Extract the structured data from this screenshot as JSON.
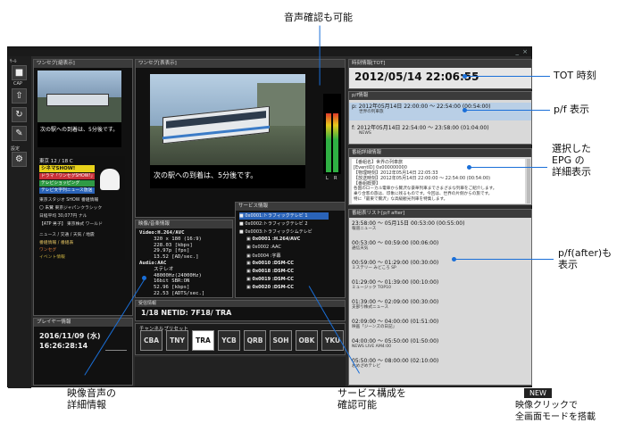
{
  "annotations": {
    "audio_check": "音声確認も可能",
    "tot_time": "TOT 時刻",
    "pf_display": "p/f 表示",
    "epg_detail": [
      "選択した",
      "EPG の",
      "詳細表示"
    ],
    "pf_after": [
      "p/f(after)も",
      "表示"
    ],
    "video_audio": [
      "映像音声の",
      "詳細情報"
    ],
    "service": [
      "サービス構成を",
      "確認可能"
    ],
    "new_badge": "NEW",
    "new_text": [
      "映像クリックで",
      "全画面モードを搭載"
    ]
  },
  "toolbar": {
    "save_label": "ｻｰﾙ",
    "cap_label": "CAP",
    "settings_label": "設定"
  },
  "panels": {
    "small_video_title": "ワンセグ[縮表示]",
    "main_video_title": "ワンセグ[表表示]",
    "tot_title": "時刻情報[TOT]",
    "pf_title": "p/f情報",
    "detail_title": "番組詳細情報",
    "after_title": "番組表リスト[p/f after]",
    "av_title": "映像/音楽情報",
    "service_title": "サービス情報",
    "netid_title": "受信情報",
    "preset_title": "チャンネルプリセット",
    "player_title": "プレイヤー情報"
  },
  "small_video": {
    "caption": "次の駅への到着は、5分後です。"
  },
  "main_video": {
    "caption": "次の駅への到着は、5分後です。",
    "level_labels": [
      "L",
      "R"
    ]
  },
  "data_broadcast": {
    "header": "東京 12 / 18 C",
    "buttons": [
      "シネマSHOW!",
      "ドラマ「ワンセグSHOW!」",
      "テレビショッピング",
      "テレビ文字列ニュース放送"
    ],
    "list": [
      "東京スタジオ SHOW 番組情報",
      "〇 朱鷺 東京ジャパンクラシック",
      "日経平均 30,077円 ナル",
      "【ATP 男子】 東京株式 ワールド"
    ],
    "links": [
      "ニュース / 交通 / 天気 / 地震",
      "番組情報 / 番組表",
      "ワンセグ",
      "イベント情報"
    ]
  },
  "tot": {
    "datetime": "2012/05/14 22:06:55"
  },
  "pf": {
    "items": [
      {
        "tag": "p:",
        "time": "2012年05月14日 22:00:00 ～ 22:54:00 (00:54:00)",
        "title": "世界の列車旅"
      },
      {
        "tag": "f:",
        "time": "2012年05月14日 22:54:00 ～ 23:58:00 (01:04:00)",
        "title": "NEWS"
      }
    ]
  },
  "detail": {
    "lines": [
      "【番組名】世界の列車旅",
      "[EventID] 0x000000000",
      "【物理時刻】2012年05月14日 22:05:33",
      "【放送時刻】2012年05月14日 22:00:00 ～ 22:54:00 (00:54:00)",
      "【番組概要】",
      "各国のローカル電車から贅沢な豪華列車までさまざまな列車をご紹介します。",
      "乗り合客の旅は、印象に残るものです。今回は、世界の片側からの旅です。",
      "特に「最東で贅沢」な高級観光列車を特集します。"
    ]
  },
  "after": {
    "items": [
      {
        "time": "23:58:00 ～ 05月15日 00:53:00 (00:55:00)",
        "title": "報道ニュース"
      },
      {
        "time": "00:53:00 ～ 00:59:00 (00:06:00)",
        "title": "通信天気"
      },
      {
        "time": "00:59:00 ～ 01:29:00 (00:30:00)",
        "title": "ミステリー みどころ SP"
      },
      {
        "time": "01:29:00 ～ 01:39:00 (00:10:00)",
        "title": "ミュージック TOP10"
      },
      {
        "time": "01:39:00 ～ 02:09:00 (00:30:00)",
        "title": "支部り株式ニュース"
      },
      {
        "time": "02:09:00 ～ 04:00:00 (01:51:00)",
        "title": "映画「ジーンズの日記」"
      },
      {
        "time": "04:00:00 ～ 05:50:00 (01:50:00)",
        "title": "NEWS LIVE AM4:00"
      },
      {
        "time": "05:50:00 ～ 08:00:00 (02:10:00)",
        "title": "おめざめテレビ"
      }
    ]
  },
  "av": {
    "lines": [
      "Video:H.264/AVC",
      "320 x 180 (16:9)",
      "228.03 [kbps]",
      "29.97p [fps]",
      "13.52 [AD/sec.]",
      "Audio:AAC",
      "ステレオ",
      "48000Hz(24000Hz)",
      "16bit SBR:ON",
      "52.96 [kbps]",
      "22.53 [ADTS/sec.]"
    ]
  },
  "services": {
    "rows": [
      {
        "label": "0x0001:トラフィックテレビ 1"
      },
      {
        "label": "0x0002:トラフィックテレビ 2"
      },
      {
        "label": "0x0003:トラフィックシムテレビ"
      },
      {
        "label": "0x0001 :H.264/AVC"
      },
      {
        "label": "0x0002 :AAC"
      },
      {
        "label": "0x0004 :字幕"
      },
      {
        "label": "0x0010 :DSM-CC"
      },
      {
        "label": "0x0018 :DSM-CC"
      },
      {
        "label": "0x0019 :DSM-CC"
      },
      {
        "label": "0x0020 :DSM-CC"
      }
    ]
  },
  "netid": {
    "value": "1/18 NETID: 7F18/ TRA"
  },
  "presets": {
    "channels": [
      "CBA",
      "TNY",
      "TRA",
      "YCB",
      "QRB",
      "SOH",
      "OBK",
      "YKU"
    ],
    "selected": "TRA"
  },
  "player": {
    "date": "2016/11/09 (水)",
    "time": "16:26:28:14"
  },
  "colors": {
    "annotation_line": "#1a6fd8",
    "app_bg": "#2b2b2b",
    "epg_bg": "#d9d9d9"
  }
}
